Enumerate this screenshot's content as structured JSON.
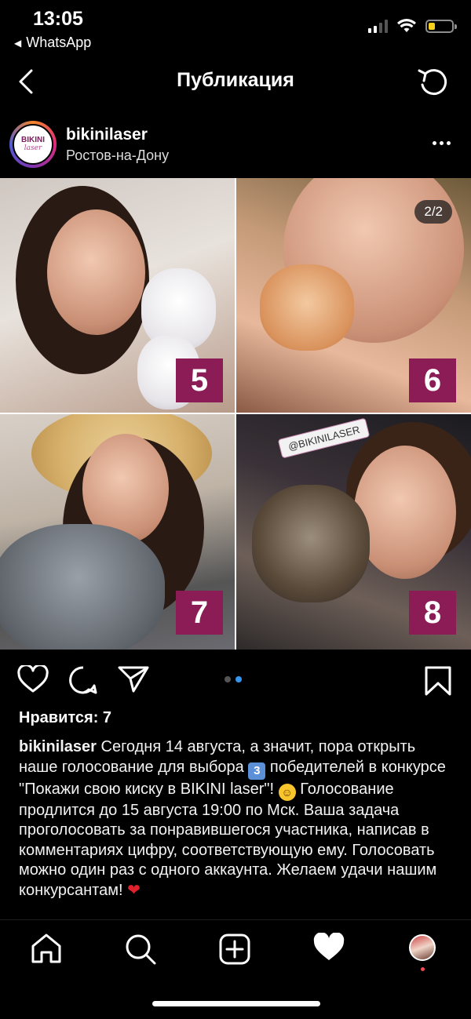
{
  "status_bar": {
    "time": "13:05",
    "back_app": "WhatsApp"
  },
  "nav": {
    "title": "Публикация",
    "back_icon": "chevron-left-icon",
    "refresh_icon": "refresh-icon"
  },
  "post": {
    "avatar_logo_top": "BIKINI",
    "avatar_logo_bottom": "laser",
    "username": "bikinilaser",
    "location": "Ростов-на-Дону",
    "carousel_counter": "2/2",
    "photo_numbers": [
      "5",
      "6",
      "7",
      "8"
    ],
    "photo_tag": "@BIKINILASER",
    "likes": "Нравится: 7",
    "caption_user": "bikinilaser",
    "caption_part1": "Сегодня 14 августа, а значит, пора открыть наше голосование для выбора",
    "caption_emoji_digit": "3",
    "caption_part2": "победителей в конкурсе \"Покажи свою киску в BIKINI laser\"!",
    "caption_part3": "Голосование продлится до 15 августа 19:00 по Мск. Ваша задача проголосовать за понравившегося участника, написав в комментариях цифру, соответствующую ему. Голосовать можно один раз с одного аккаунта. Желаем удачи нашим конкурсантам!",
    "carousel_pages": 2,
    "carousel_active": 2
  },
  "colors": {
    "badge_magenta": "#8c1c55",
    "carousel_dot_active": "#3797f0",
    "battery": "#f7d11b"
  },
  "tabbar": {
    "items": [
      "home-icon",
      "search-icon",
      "new-post-icon",
      "activity-heart-icon",
      "profile-avatar"
    ]
  }
}
